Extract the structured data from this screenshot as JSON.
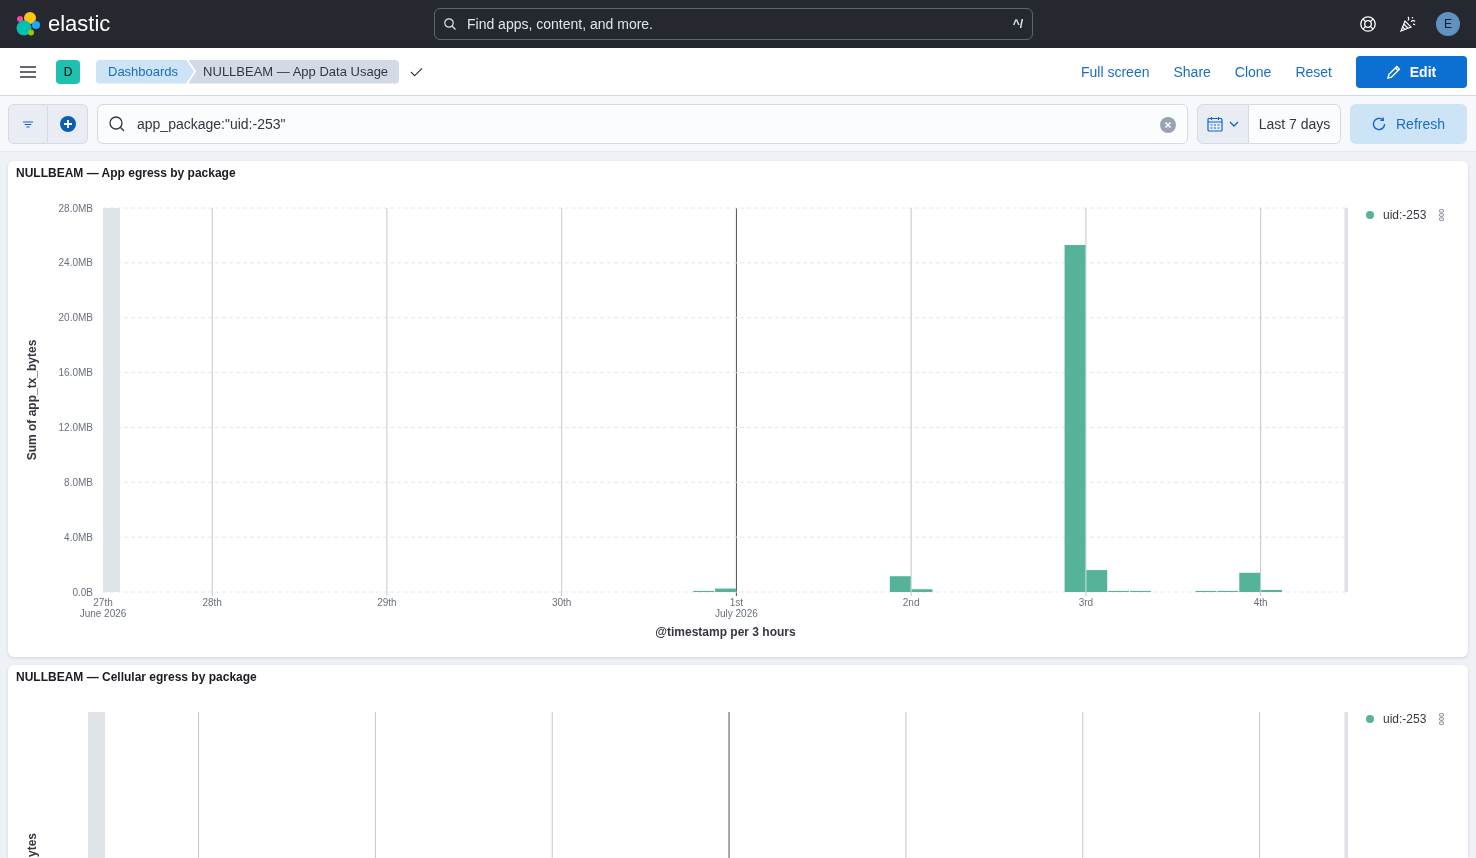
{
  "header": {
    "logo_text": "elastic",
    "search": {
      "placeholder": "Find apps, content, and more.",
      "shortcut": "^/"
    },
    "avatar": "E"
  },
  "toolbar": {
    "space_badge": "D",
    "breadcrumbs": [
      {
        "label": "Dashboards",
        "selected": false
      },
      {
        "label": "NULLBEAM — App Data Usage",
        "selected": true
      }
    ],
    "actions": [
      "Full screen",
      "Share",
      "Clone",
      "Reset"
    ],
    "primary_action": "Edit"
  },
  "query_bar": {
    "query": "app_package:\"uid:-253\"",
    "date_range": "Last 7 days",
    "refresh": "Refresh"
  },
  "panels": [
    {
      "title": "NULLBEAM — App egress by package",
      "chart_data": {
        "type": "bar",
        "xlabel": "@timestamp per 3 hours",
        "ylabel": "Sum of app_tx_bytes",
        "x": [
          "2026-06-30 19:30",
          "2026-06-30 22:30",
          "2026-07-01 22:30",
          "2026-07-02 01:30",
          "2026-07-02 22:30",
          "2026-07-03 01:30",
          "2026-07-03 04:30",
          "2026-07-03 07:30",
          "2026-07-03 16:30",
          "2026-07-03 19:30",
          "2026-07-03 22:30",
          "2026-07-04 01:30"
        ],
        "series": [
          {
            "name": "uid:-253",
            "color": "#54b399",
            "values": [
              0.08,
              0.25,
              1.15,
              0.2,
              25.3,
              1.6,
              0.08,
              0.08,
              0.08,
              0.08,
              1.4,
              0.15
            ]
          }
        ],
        "xlim": [
          "2026-06-27 09:00",
          "2026-07-04 12:00"
        ],
        "ylim": [
          0,
          28
        ],
        "xticks": [
          {
            "value": "2026-06-27 09:00",
            "label": "27th"
          },
          {
            "value": "2026-06-28 00:00",
            "label": "28th"
          },
          {
            "value": "2026-06-29 00:00",
            "label": "29th"
          },
          {
            "value": "2026-06-30 00:00",
            "label": "30th"
          },
          {
            "value": "2026-07-01 00:00",
            "label": "1st"
          },
          {
            "value": "2026-07-02 00:00",
            "label": "2nd"
          },
          {
            "value": "2026-07-03 00:00",
            "label": "3rd"
          },
          {
            "value": "2026-07-04 00:00",
            "label": "4th"
          }
        ],
        "yticks": [
          {
            "value": 0,
            "label": "0.0B"
          },
          {
            "value": 4,
            "label": "4.0MB"
          },
          {
            "value": 8,
            "label": "8.0MB"
          },
          {
            "value": 12,
            "label": "12.0MB"
          },
          {
            "value": 16,
            "label": "16.0MB"
          },
          {
            "value": 20,
            "label": "20.0MB"
          },
          {
            "value": 24,
            "label": "24.0MB"
          },
          {
            "value": 28,
            "label": "28.0MB"
          }
        ],
        "grid": true,
        "annotations": [
          "June 2026",
          "July 2026"
        ]
      }
    },
    {
      "title": "NULLBEAM — Cellular egress by package",
      "y_axis_title": "ytes",
      "legend": [
        {
          "label": "uid:-253",
          "color": "#54b399"
        }
      ]
    }
  ]
}
